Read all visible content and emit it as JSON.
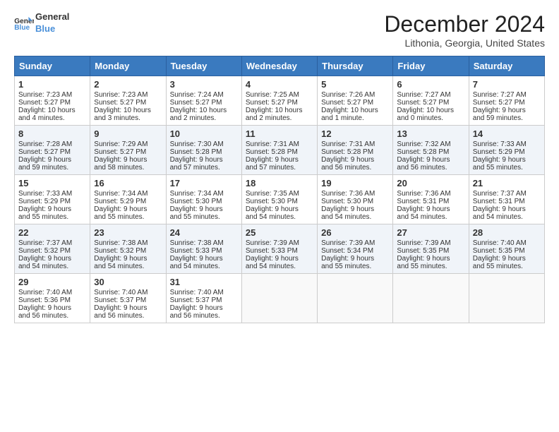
{
  "header": {
    "logo_line1": "General",
    "logo_line2": "Blue",
    "title": "December 2024",
    "subtitle": "Lithonia, Georgia, United States"
  },
  "weekdays": [
    "Sunday",
    "Monday",
    "Tuesday",
    "Wednesday",
    "Thursday",
    "Friday",
    "Saturday"
  ],
  "weeks": [
    [
      {
        "day": "1",
        "lines": [
          "Sunrise: 7:23 AM",
          "Sunset: 5:27 PM",
          "Daylight: 10 hours",
          "and 4 minutes."
        ]
      },
      {
        "day": "2",
        "lines": [
          "Sunrise: 7:23 AM",
          "Sunset: 5:27 PM",
          "Daylight: 10 hours",
          "and 3 minutes."
        ]
      },
      {
        "day": "3",
        "lines": [
          "Sunrise: 7:24 AM",
          "Sunset: 5:27 PM",
          "Daylight: 10 hours",
          "and 2 minutes."
        ]
      },
      {
        "day": "4",
        "lines": [
          "Sunrise: 7:25 AM",
          "Sunset: 5:27 PM",
          "Daylight: 10 hours",
          "and 2 minutes."
        ]
      },
      {
        "day": "5",
        "lines": [
          "Sunrise: 7:26 AM",
          "Sunset: 5:27 PM",
          "Daylight: 10 hours",
          "and 1 minute."
        ]
      },
      {
        "day": "6",
        "lines": [
          "Sunrise: 7:27 AM",
          "Sunset: 5:27 PM",
          "Daylight: 10 hours",
          "and 0 minutes."
        ]
      },
      {
        "day": "7",
        "lines": [
          "Sunrise: 7:27 AM",
          "Sunset: 5:27 PM",
          "Daylight: 9 hours",
          "and 59 minutes."
        ]
      }
    ],
    [
      {
        "day": "8",
        "lines": [
          "Sunrise: 7:28 AM",
          "Sunset: 5:27 PM",
          "Daylight: 9 hours",
          "and 59 minutes."
        ]
      },
      {
        "day": "9",
        "lines": [
          "Sunrise: 7:29 AM",
          "Sunset: 5:27 PM",
          "Daylight: 9 hours",
          "and 58 minutes."
        ]
      },
      {
        "day": "10",
        "lines": [
          "Sunrise: 7:30 AM",
          "Sunset: 5:28 PM",
          "Daylight: 9 hours",
          "and 57 minutes."
        ]
      },
      {
        "day": "11",
        "lines": [
          "Sunrise: 7:31 AM",
          "Sunset: 5:28 PM",
          "Daylight: 9 hours",
          "and 57 minutes."
        ]
      },
      {
        "day": "12",
        "lines": [
          "Sunrise: 7:31 AM",
          "Sunset: 5:28 PM",
          "Daylight: 9 hours",
          "and 56 minutes."
        ]
      },
      {
        "day": "13",
        "lines": [
          "Sunrise: 7:32 AM",
          "Sunset: 5:28 PM",
          "Daylight: 9 hours",
          "and 56 minutes."
        ]
      },
      {
        "day": "14",
        "lines": [
          "Sunrise: 7:33 AM",
          "Sunset: 5:29 PM",
          "Daylight: 9 hours",
          "and 55 minutes."
        ]
      }
    ],
    [
      {
        "day": "15",
        "lines": [
          "Sunrise: 7:33 AM",
          "Sunset: 5:29 PM",
          "Daylight: 9 hours",
          "and 55 minutes."
        ]
      },
      {
        "day": "16",
        "lines": [
          "Sunrise: 7:34 AM",
          "Sunset: 5:29 PM",
          "Daylight: 9 hours",
          "and 55 minutes."
        ]
      },
      {
        "day": "17",
        "lines": [
          "Sunrise: 7:34 AM",
          "Sunset: 5:30 PM",
          "Daylight: 9 hours",
          "and 55 minutes."
        ]
      },
      {
        "day": "18",
        "lines": [
          "Sunrise: 7:35 AM",
          "Sunset: 5:30 PM",
          "Daylight: 9 hours",
          "and 54 minutes."
        ]
      },
      {
        "day": "19",
        "lines": [
          "Sunrise: 7:36 AM",
          "Sunset: 5:30 PM",
          "Daylight: 9 hours",
          "and 54 minutes."
        ]
      },
      {
        "day": "20",
        "lines": [
          "Sunrise: 7:36 AM",
          "Sunset: 5:31 PM",
          "Daylight: 9 hours",
          "and 54 minutes."
        ]
      },
      {
        "day": "21",
        "lines": [
          "Sunrise: 7:37 AM",
          "Sunset: 5:31 PM",
          "Daylight: 9 hours",
          "and 54 minutes."
        ]
      }
    ],
    [
      {
        "day": "22",
        "lines": [
          "Sunrise: 7:37 AM",
          "Sunset: 5:32 PM",
          "Daylight: 9 hours",
          "and 54 minutes."
        ]
      },
      {
        "day": "23",
        "lines": [
          "Sunrise: 7:38 AM",
          "Sunset: 5:32 PM",
          "Daylight: 9 hours",
          "and 54 minutes."
        ]
      },
      {
        "day": "24",
        "lines": [
          "Sunrise: 7:38 AM",
          "Sunset: 5:33 PM",
          "Daylight: 9 hours",
          "and 54 minutes."
        ]
      },
      {
        "day": "25",
        "lines": [
          "Sunrise: 7:39 AM",
          "Sunset: 5:33 PM",
          "Daylight: 9 hours",
          "and 54 minutes."
        ]
      },
      {
        "day": "26",
        "lines": [
          "Sunrise: 7:39 AM",
          "Sunset: 5:34 PM",
          "Daylight: 9 hours",
          "and 55 minutes."
        ]
      },
      {
        "day": "27",
        "lines": [
          "Sunrise: 7:39 AM",
          "Sunset: 5:35 PM",
          "Daylight: 9 hours",
          "and 55 minutes."
        ]
      },
      {
        "day": "28",
        "lines": [
          "Sunrise: 7:40 AM",
          "Sunset: 5:35 PM",
          "Daylight: 9 hours",
          "and 55 minutes."
        ]
      }
    ],
    [
      {
        "day": "29",
        "lines": [
          "Sunrise: 7:40 AM",
          "Sunset: 5:36 PM",
          "Daylight: 9 hours",
          "and 56 minutes."
        ]
      },
      {
        "day": "30",
        "lines": [
          "Sunrise: 7:40 AM",
          "Sunset: 5:37 PM",
          "Daylight: 9 hours",
          "and 56 minutes."
        ]
      },
      {
        "day": "31",
        "lines": [
          "Sunrise: 7:40 AM",
          "Sunset: 5:37 PM",
          "Daylight: 9 hours",
          "and 56 minutes."
        ]
      },
      null,
      null,
      null,
      null
    ]
  ]
}
